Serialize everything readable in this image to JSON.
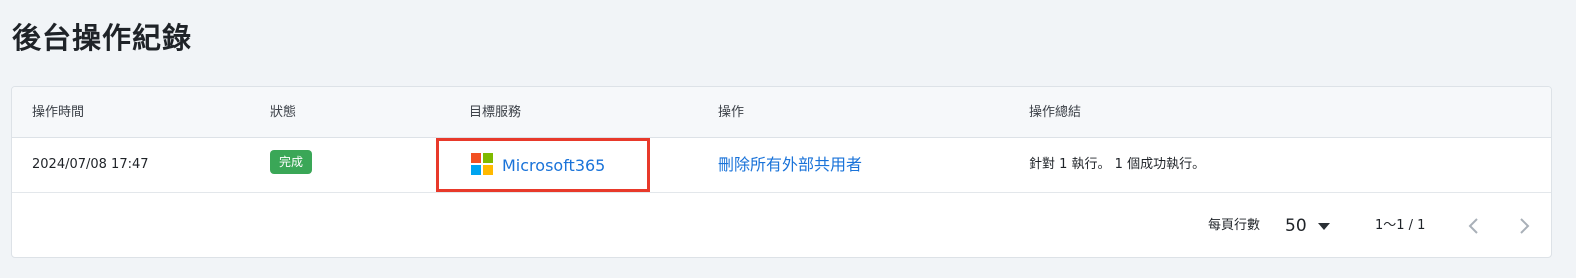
{
  "page": {
    "title": "後台操作紀錄"
  },
  "table": {
    "columns": [
      "操作時間",
      "狀態",
      "目標服務",
      "操作",
      "操作總結"
    ],
    "rows": [
      {
        "time": "2024/07/08 17:47",
        "status": "完成",
        "service": "Microsoft365",
        "service_icon": "microsoft-logo-icon",
        "operation": "刪除所有外部共用者",
        "summary": "針對 1 執行。 1 個成功執行。"
      }
    ]
  },
  "pagination": {
    "rows_per_page_label": "每頁行數",
    "rows_per_page_value": "50",
    "range": "1〜1 / 1",
    "prev_icon": "chevron-left-icon",
    "next_icon": "chevron-right-icon"
  },
  "colors": {
    "status_success": "#3aa757",
    "link": "#1a73d9",
    "highlight_border": "#e8392a"
  }
}
